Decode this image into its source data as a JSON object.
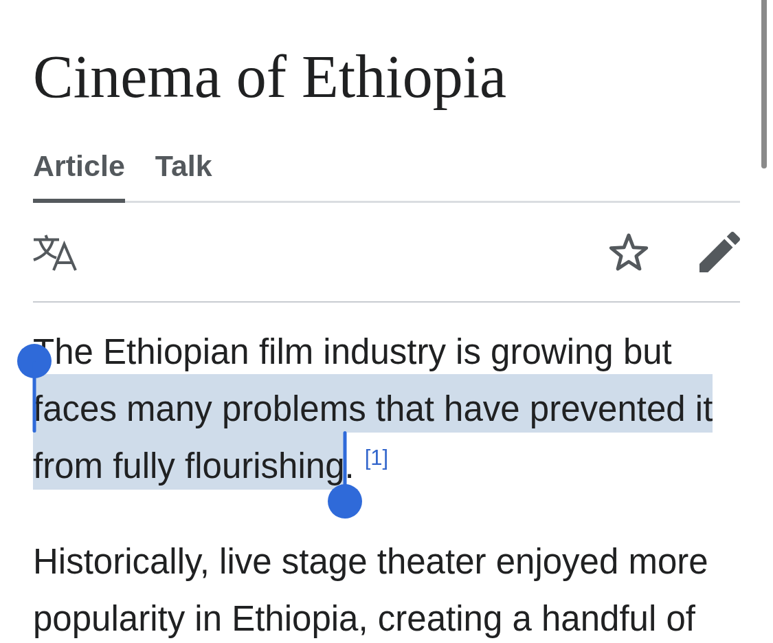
{
  "article": {
    "title": "Cinema of Ethiopia"
  },
  "tabs": [
    {
      "label": "Article",
      "selected": true
    },
    {
      "label": "Talk",
      "selected": false
    }
  ],
  "paragraphs": [
    {
      "segments": [
        {
          "text": "The Ethiopian film industry is growing but ",
          "selected": false
        },
        {
          "text": "faces many problems that have prevented it from fully flourishing",
          "selected": true
        },
        {
          "text": ".",
          "selected": false
        }
      ],
      "footnote": "[1]"
    },
    {
      "segments": [
        {
          "text": "Historically, live stage theater enjoyed more popularity in Ethiopia, creating a handful of",
          "selected": false
        }
      ]
    }
  ]
}
